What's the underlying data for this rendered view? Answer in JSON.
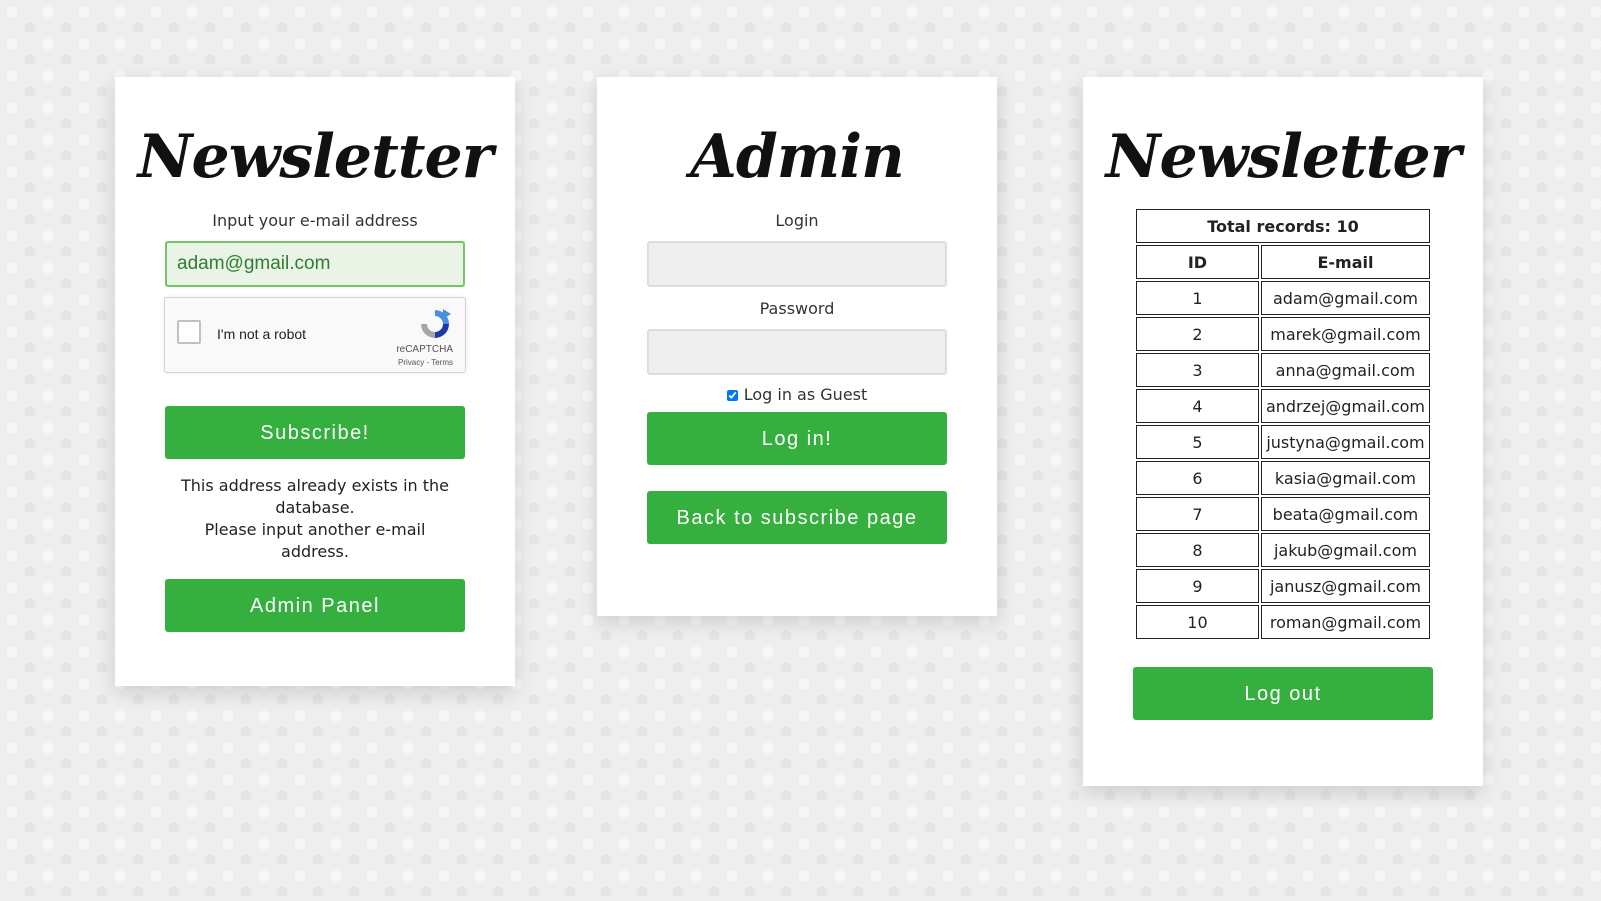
{
  "subscribe": {
    "title": "Newsletter",
    "prompt": "Input your e-mail address",
    "email_value": "adam@gmail.com",
    "recaptcha": {
      "label": "I'm not a robot",
      "brand": "reCAPTCHA",
      "links": "Privacy - Terms",
      "icon": "recaptcha-logo-icon"
    },
    "subscribe_button": "Subscribe!",
    "message_line1": "This address already exists in the database.",
    "message_line2": "Please input another e-mail address.",
    "admin_button": "Admin Panel"
  },
  "admin": {
    "title": "Admin",
    "login_label": "Login",
    "login_value": "",
    "password_label": "Password",
    "password_value": "",
    "guest_label": "Log in as Guest",
    "guest_checked": true,
    "login_button": "Log in!",
    "back_button": "Back to subscribe page"
  },
  "records": {
    "title": "Newsletter",
    "total_label": "Total records: 10",
    "headers": {
      "id": "ID",
      "email": "E-mail"
    },
    "rows": [
      {
        "id": "1",
        "email": "adam@gmail.com"
      },
      {
        "id": "2",
        "email": "marek@gmail.com"
      },
      {
        "id": "3",
        "email": "anna@gmail.com"
      },
      {
        "id": "4",
        "email": "andrzej@gmail.com"
      },
      {
        "id": "5",
        "email": "justyna@gmail.com"
      },
      {
        "id": "6",
        "email": "kasia@gmail.com"
      },
      {
        "id": "7",
        "email": "beata@gmail.com"
      },
      {
        "id": "8",
        "email": "jakub@gmail.com"
      },
      {
        "id": "9",
        "email": "janusz@gmail.com"
      },
      {
        "id": "10",
        "email": "roman@gmail.com"
      }
    ],
    "logout_button": "Log out"
  },
  "colors": {
    "accent": "#35b03f",
    "card": "#ffffff",
    "background": "#eeeeee",
    "input_bg": "#eeeeee",
    "input_active_bg": "#eaf4e6"
  }
}
